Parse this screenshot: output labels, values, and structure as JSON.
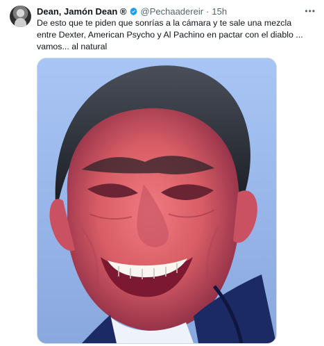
{
  "tweet": {
    "author": {
      "display_name": "Dean, Jamón Dean ®",
      "handle": "@Pechaadereir",
      "separator": "·",
      "time": "15h",
      "avatar_icon": "avatar-photo-icon",
      "verified_icon": "verified-badge-icon"
    },
    "text": "De esto que te piden que sonrías a la cámara y te sale una mezcla entre Dexter, American Psycho y Al Pachino en pactar con el diablo ... vamos... al natural",
    "more_icon": "more-dots-icon",
    "media": {
      "description_icon": "portrait-photo-icon",
      "background_color": "#9bb8e7",
      "face_color": "#d85d66",
      "hair_color": "#25282f",
      "suit_color": "#1c2a63",
      "shirt_color": "#eef2fb"
    },
    "colors": {
      "text": "#0f1419",
      "muted": "#536471",
      "verified": "#1d9bf0",
      "border": "#cfd9de"
    }
  }
}
